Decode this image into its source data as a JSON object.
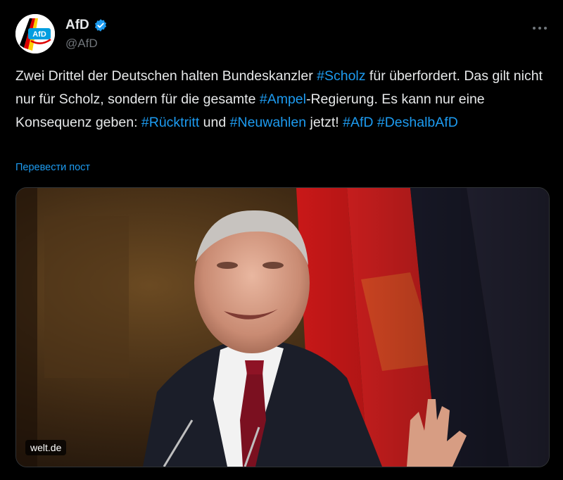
{
  "author": {
    "name": "AfD",
    "handle": "@AfD",
    "avatar_text": "AfD",
    "verified_icon": "verified-badge-icon"
  },
  "more_icon": "more-options-icon",
  "tweet": {
    "segments": [
      {
        "text": "Zwei Drittel der Deutschen halten Bundeskanzler ",
        "type": "text"
      },
      {
        "text": "#Scholz",
        "type": "hashtag"
      },
      {
        "text": " für überfordert. Das gilt nicht nur für Scholz, sondern für die gesamte ",
        "type": "text"
      },
      {
        "text": "#Ampel",
        "type": "hashtag"
      },
      {
        "text": "-Regierung. Es kann nur eine Konsequenz geben: ",
        "type": "text"
      },
      {
        "text": "#Rücktritt",
        "type": "hashtag"
      },
      {
        "text": " und ",
        "type": "text"
      },
      {
        "text": "#Neuwahlen",
        "type": "hashtag"
      },
      {
        "text": " jetzt! ",
        "type": "text"
      },
      {
        "text": "#AfD",
        "type": "hashtag"
      },
      {
        "text": " ",
        "type": "text"
      },
      {
        "text": "#DeshalbAfD",
        "type": "hashtag"
      }
    ],
    "translate_label": "Перевести пост"
  },
  "media": {
    "source_label": "welt.de"
  },
  "colors": {
    "background": "#000000",
    "text": "#e7e9ea",
    "muted": "#71767b",
    "link": "#1d9bf0",
    "brand_blue": "#009ee0"
  }
}
